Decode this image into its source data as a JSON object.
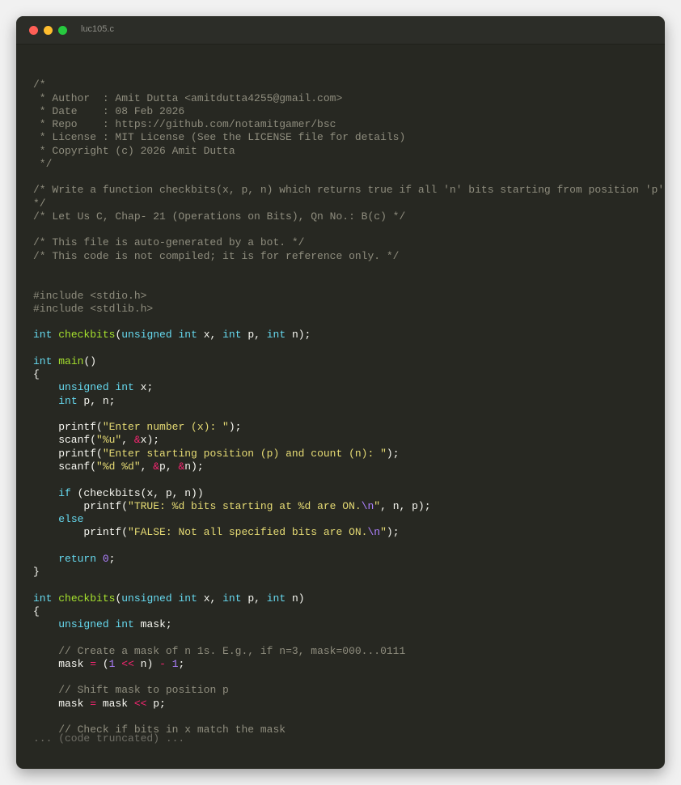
{
  "window": {
    "title": "luc105.c"
  },
  "code_lines": [
    [],
    [
      "c",
      "/*"
    ],
    [
      "c",
      " * Author  : Amit Dutta <amitdutta4255@gmail.com>"
    ],
    [
      "c",
      " * Date    : 08 Feb 2026"
    ],
    [
      "c",
      " * Repo    : https://github.com/notamitgamer/bsc"
    ],
    [
      "c",
      " * License : MIT License (See the LICENSE file for details)"
    ],
    [
      "c",
      " * Copyright (c) 2026 Amit Dutta"
    ],
    [
      "c",
      " */"
    ],
    [],
    [
      "c",
      "/* Write a function checkbits(x, p, n) which returns true if all 'n' bits starting from position 'p' are turned on. Otherwise, return false."
    ],
    [
      "c",
      "*/"
    ],
    [
      "c",
      "/* Let Us C, Chap- 21 (Operations on Bits), Qn No.: B(c) */"
    ],
    [],
    [
      "c",
      "/* This file is auto-generated by a bot. */"
    ],
    [
      "c",
      "/* This code is not compiled; it is for reference only. */"
    ],
    [],
    [],
    [
      "c",
      "#include <stdio.h>"
    ],
    [
      "c",
      "#include <stdlib.h>"
    ],
    [],
    [
      "k",
      "int",
      "p",
      " ",
      "f",
      "checkbits",
      "p",
      "(",
      "k",
      "unsigned",
      "p",
      " ",
      "k",
      "int",
      "p",
      " x, ",
      "k",
      "int",
      "p",
      " p, ",
      "k",
      "int",
      "p",
      " n);"
    ],
    [],
    [
      "k",
      "int",
      "p",
      " ",
      "f",
      "main",
      "p",
      "()"
    ],
    [
      "p",
      "{"
    ],
    [
      "p",
      "    ",
      "k",
      "unsigned",
      "p",
      " ",
      "k",
      "int",
      "p",
      " x;"
    ],
    [
      "p",
      "    ",
      "k",
      "int",
      "p",
      " p, n;"
    ],
    [],
    [
      "p",
      "    printf(",
      "s",
      "\"Enter number (x): \"",
      "p",
      ");"
    ],
    [
      "p",
      "    scanf(",
      "s",
      "\"%u\"",
      "p",
      ", ",
      "o",
      "&",
      "p",
      "x);"
    ],
    [
      "p",
      "    printf(",
      "s",
      "\"Enter starting position (p) and count (n): \"",
      "p",
      ");"
    ],
    [
      "p",
      "    scanf(",
      "s",
      "\"%d %d\"",
      "p",
      ", ",
      "o",
      "&",
      "p",
      "p, ",
      "o",
      "&",
      "p",
      "n);"
    ],
    [],
    [
      "p",
      "    ",
      "k",
      "if",
      "p",
      " (checkbits(x, p, n))"
    ],
    [
      "p",
      "        printf(",
      "s",
      "\"TRUE: %d bits starting at %d are ON.",
      "e",
      "\\n",
      "s",
      "\"",
      "p",
      ", n, p);"
    ],
    [
      "p",
      "    ",
      "k",
      "else"
    ],
    [
      "p",
      "        printf(",
      "s",
      "\"FALSE: Not all specified bits are ON.",
      "e",
      "\\n",
      "s",
      "\"",
      "p",
      ");"
    ],
    [],
    [
      "p",
      "    ",
      "k",
      "return",
      "p",
      " ",
      "n",
      "0",
      "p",
      ";"
    ],
    [
      "p",
      "}"
    ],
    [],
    [
      "k",
      "int",
      "p",
      " ",
      "f",
      "checkbits",
      "p",
      "(",
      "k",
      "unsigned",
      "p",
      " ",
      "k",
      "int",
      "p",
      " x, ",
      "k",
      "int",
      "p",
      " p, ",
      "k",
      "int",
      "p",
      " n)"
    ],
    [
      "p",
      "{"
    ],
    [
      "p",
      "    ",
      "k",
      "unsigned",
      "p",
      " ",
      "k",
      "int",
      "p",
      " mask;"
    ],
    [],
    [
      "p",
      "    ",
      "c",
      "// Create a mask of n 1s. E.g., if n=3, mask=000...0111"
    ],
    [
      "p",
      "    mask ",
      "o",
      "=",
      "p",
      " (",
      "n",
      "1",
      "p",
      " ",
      "o",
      "<<",
      "p",
      " n) ",
      "o",
      "-",
      "p",
      " ",
      "n",
      "1",
      "p",
      ";"
    ],
    [],
    [
      "p",
      "    ",
      "c",
      "// Shift mask to position p"
    ],
    [
      "p",
      "    mask ",
      "o",
      "=",
      "p",
      " mask ",
      "o",
      "<<",
      "p",
      " p;"
    ],
    [],
    [
      "p",
      "    ",
      "c",
      "// Check if bits in x match the mask"
    ]
  ],
  "truncation_note": "... (code truncated) ..."
}
